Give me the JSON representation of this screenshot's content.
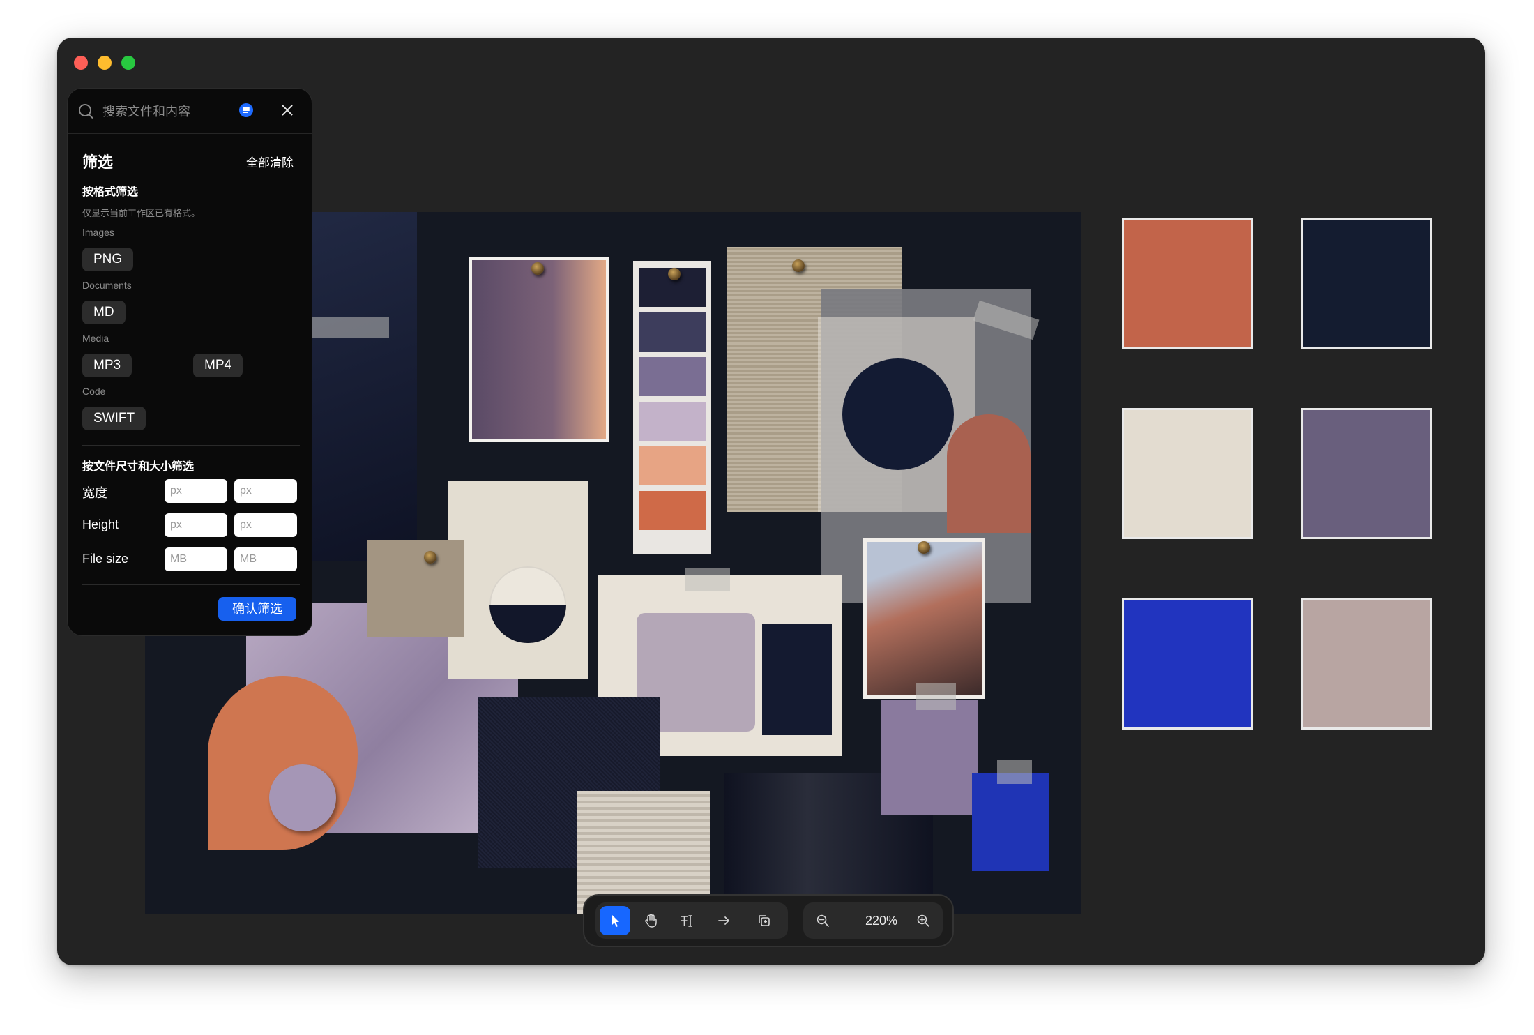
{
  "window": {
    "title_bar": {
      "buttons": [
        "close",
        "minimize",
        "zoom"
      ]
    }
  },
  "search": {
    "placeholder": "搜索文件和内容",
    "icons": [
      "search-icon",
      "filter-toggle-icon",
      "close-icon"
    ]
  },
  "filter": {
    "title": "筛选",
    "clear_all": "全部清除",
    "format_section": {
      "heading": "按格式筛选",
      "hint": "仅显示当前工作区已有格式。",
      "groups": [
        {
          "label": "Images",
          "chips": [
            "PNG"
          ]
        },
        {
          "label": "Documents",
          "chips": [
            "MD"
          ]
        },
        {
          "label": "Media",
          "chips": [
            "MP3",
            "MP4"
          ]
        },
        {
          "label": "Code",
          "chips": [
            "SWIFT"
          ]
        }
      ]
    },
    "size_section": {
      "heading": "按文件尺寸和大小筛选",
      "rows": [
        {
          "label": "宽度",
          "min_placeholder": "px",
          "max_placeholder": "px"
        },
        {
          "label": "Height",
          "min_placeholder": "px",
          "max_placeholder": "px"
        },
        {
          "label": "File size",
          "min_placeholder": "MB",
          "max_placeholder": "MB"
        }
      ]
    },
    "confirm_label": "确认筛选"
  },
  "swatches": {
    "colors": [
      "#c2644a",
      "#141c30",
      "#e3dcd0",
      "#695f7d",
      "#2134bf",
      "#b8a5a2"
    ]
  },
  "toolbar": {
    "tools": [
      "pointer-icon",
      "hand-icon",
      "text-select-icon",
      "arrow-icon",
      "duplicate-icon"
    ],
    "active_tool": "pointer-icon",
    "zoom_level": "220%",
    "zoom_out_icon": "zoom-out-icon",
    "zoom_in_icon": "zoom-in-icon"
  }
}
